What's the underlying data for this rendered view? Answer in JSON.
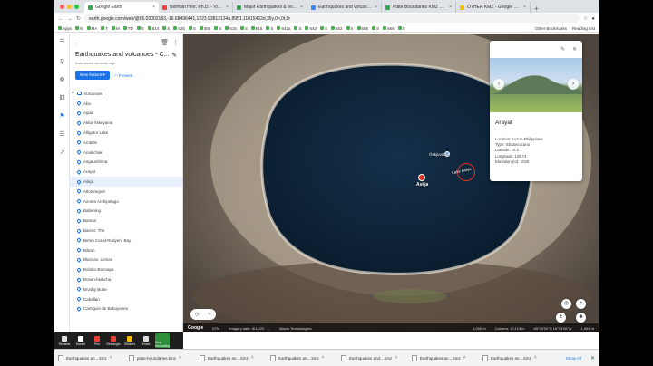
{
  "browser": {
    "tabs": [
      {
        "label": "Google Earth",
        "color": "#34a853",
        "active": true
      },
      {
        "label": "Norman Herr, Ph.D. - Video Tu...",
        "color": "#ea4335",
        "active": false
      },
      {
        "label": "Major Earthquakes & Volcanoes ...",
        "color": "#34a853",
        "active": false
      },
      {
        "label": "Earthquakes and volcanoes - ...",
        "color": "#4285f4",
        "active": false
      },
      {
        "label": "Plate Boundaries KMZ File | U...",
        "color": "#34a853",
        "active": false
      },
      {
        "label": "OTHER KMZ - Google Drive",
        "color": "#fbbc04",
        "active": false
      }
    ],
    "url": "earth.google.com/web/@65.03002183,-16.68496441,1223.93813134a,8951.11015462d,35y,0h,0t,0r",
    "bookmarks": [
      "Apps",
      "N",
      "MA",
      "T",
      "M",
      "TD",
      "S",
      "514",
      "S",
      "525",
      "S",
      "555",
      "S",
      "615",
      "S",
      "615",
      "S",
      "642a",
      "S",
      "642",
      "S",
      "652",
      "S",
      "658",
      "S",
      "666",
      "S"
    ],
    "other_bookmarks": "Other Bookmarks",
    "reading_list": "Reading List"
  },
  "panel": {
    "project_title": "Earthquakes and volcanoes - C...",
    "autosave": "Auto-saved seconds ago",
    "new_feature": "New feature",
    "present": "Present",
    "folder": "Volcanoes",
    "items": [
      "Abu",
      "Agua",
      "Akita-Yakeyama",
      "Alligator Lake",
      "Ambitle",
      "Aniakchak",
      "Asgaurshima",
      "Arayat",
      "Askja",
      "Atlotonepuri",
      "Azores Archipelago",
      "Babening",
      "Bamus",
      "Barrier, The",
      "Behm Canal-Rudyerd Bay",
      "Biliran",
      "Blancas, Lomas",
      "Bolaño-Bannapa",
      "Bosen-berscha",
      "Brushy Butte",
      "Caballan",
      "Camiguin de Babuyanes"
    ],
    "selected_index": 8
  },
  "map": {
    "labels": {
      "askja": "Askja",
      "oskjuvatn": "Öskjuvatn",
      "lake": "Lake Askja"
    },
    "status": {
      "logo": "Google",
      "zoom": "67%",
      "imagery": "Imagery date: 8/14/20 · ...",
      "credits": "Maxar Technologies",
      "scale": "1,000 m",
      "camera": "Camera: 10,119 m",
      "coords": "65°03'00\"N 16°43'06\"W",
      "elevation": "1,064 m"
    }
  },
  "card": {
    "name": "Arayat",
    "lines": [
      "Location: Luzon-Philippines",
      "Type: Stratovolcano",
      "Latitude: 15.2",
      "Longitude: 120.74",
      "Elevation (m): 1026"
    ]
  },
  "zoom_toolbar": [
    {
      "label": "Rename",
      "color": "#e0e0e0"
    },
    {
      "label": "Mouse",
      "color": "#ffffff"
    },
    {
      "label": "Pen",
      "color": "#ea4335"
    },
    {
      "label": "Rectangle",
      "color": "#ea4335"
    },
    {
      "label": "Stickers",
      "color": "#fbbc04"
    },
    {
      "label": "Erase",
      "color": "#dddddd"
    },
    {
      "label": "Stop Annotating",
      "color": "#2d8f3a"
    }
  ],
  "downloads": [
    "Earthquakes an....kmz",
    "plate-boundaries.kmz",
    "Earthquakes an....kmz",
    "Earthquakes an....kmz",
    "Earthquakes and....kmz",
    "Earthquakes an....kmz",
    "Earthquakes an....kmz"
  ],
  "show_all": "Show All"
}
